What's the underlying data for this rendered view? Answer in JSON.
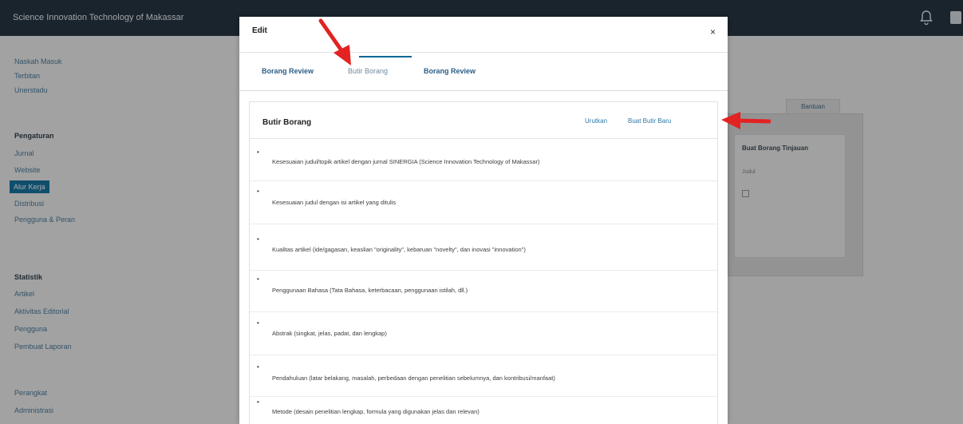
{
  "app": {
    "brand": "Science Innovation Technology of Makassar"
  },
  "sidebar": {
    "items": [
      {
        "label": "Naskah Masuk"
      },
      {
        "label": "Terbitan"
      },
      {
        "label": "Unerstadu"
      }
    ],
    "pengaturan": {
      "heading": "Pengaturan",
      "items": [
        {
          "label": "Jurnal"
        },
        {
          "label": "Website"
        },
        {
          "label": "Alur Kerja",
          "active": true
        },
        {
          "label": "Distribusi"
        },
        {
          "label": "Pengguna & Peran"
        }
      ]
    },
    "statistik": {
      "heading": "Statistik",
      "items": [
        {
          "label": "Artikel"
        },
        {
          "label": "Aktivitas Editorial"
        },
        {
          "label": "Pengguna"
        },
        {
          "label": "Pembuat Laporan"
        }
      ]
    },
    "bottom": [
      {
        "label": "Perangkat"
      },
      {
        "label": "Administrasi"
      }
    ]
  },
  "background": {
    "help_button": "Bantuan",
    "panel_title": "Buat Borang Tinjauan",
    "panel_small": "Judul"
  },
  "modal": {
    "title": "Edit",
    "close": "×",
    "tabs": [
      {
        "label": "Borang Review",
        "active": false
      },
      {
        "label": "Butir Borang",
        "active": true
      },
      {
        "label": "Borang Review",
        "active": false
      }
    ],
    "card": {
      "title": "Butir Borang",
      "actions": {
        "sort": "Urutkan",
        "create": "Buat Butir Baru"
      },
      "items": [
        {
          "text": "Kesesuaian judul/topik artikel dengan jurnal SINERGIA (Science Innovation Technology of Makassar)"
        },
        {
          "text": "Kesesuaian judul dengan isi artikel yang ditulis"
        },
        {
          "text": "Kualitas artikel (ide/gagasan, keaslian \"originality\", kebaruan \"novelty\", dan inovasi \"innovation\")"
        },
        {
          "text": "Penggunaan Bahasa (Tata Bahasa, keterbacaan, penggunaan istilah, dll.)"
        },
        {
          "text": "Abstrak (singkat, jelas, padat, dan lengkap)"
        },
        {
          "text": "Pendahuluan (latar belakang, masalah, perbedaan dengan penelitian sebelumnya, dan kontribusi/manfaat)"
        },
        {
          "text": "Metode (desain penelitian lengkap, formula yang digunakan jelas dan relevan)"
        }
      ]
    }
  },
  "annotations": {
    "arrow_color": "#e32222"
  },
  "colors": {
    "topbar": "#13222f",
    "accent": "#006798",
    "link": "#2d7aa8"
  }
}
